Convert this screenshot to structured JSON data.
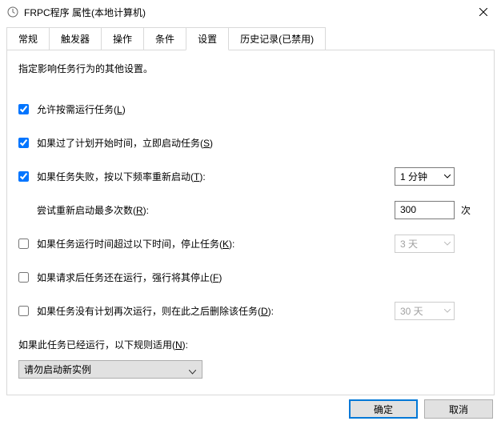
{
  "titlebar": {
    "icon": "clock-icon",
    "title": "FRPC程序 属性(本地计算机)"
  },
  "tabs": {
    "items": [
      {
        "label": "常规"
      },
      {
        "label": "触发器"
      },
      {
        "label": "操作"
      },
      {
        "label": "条件"
      },
      {
        "label": "设置"
      },
      {
        "label": "历史记录(已禁用)"
      }
    ],
    "active_index": 4
  },
  "panel": {
    "description": "指定影响任务行为的其他设置。",
    "allow_on_demand": {
      "checked": true,
      "label": "允许按需运行任务(",
      "accel": "L",
      "after": ")"
    },
    "run_asap": {
      "checked": true,
      "label": "如果过了计划开始时间，立即启动任务(",
      "accel": "S",
      "after": ")"
    },
    "restart_on_fail": {
      "checked": true,
      "label": "如果任务失败，按以下频率重新启动(",
      "accel": "T",
      "after": "):",
      "interval": "1 分钟"
    },
    "restart_attempts": {
      "label": "尝试重新启动最多次数(",
      "accel": "R",
      "after": "):",
      "value": "300",
      "unit": "次"
    },
    "stop_after": {
      "checked": false,
      "label": "如果任务运行时间超过以下时间，停止任务(",
      "accel": "K",
      "after": "):",
      "duration": "3 天"
    },
    "force_stop": {
      "checked": false,
      "label": "如果请求后任务还在运行，强行将其停止(",
      "accel": "F",
      "after": ")"
    },
    "delete_after": {
      "checked": false,
      "label": "如果任务没有计划再次运行，则在此之后删除该任务(",
      "accel": "D",
      "after": "):",
      "duration": "30 天"
    },
    "already_running": {
      "label": "如果此任务已经运行，以下规则适用(",
      "accel": "N",
      "after": "):",
      "rule": "请勿启动新实例"
    }
  },
  "buttons": {
    "ok": "确定",
    "cancel": "取消"
  }
}
